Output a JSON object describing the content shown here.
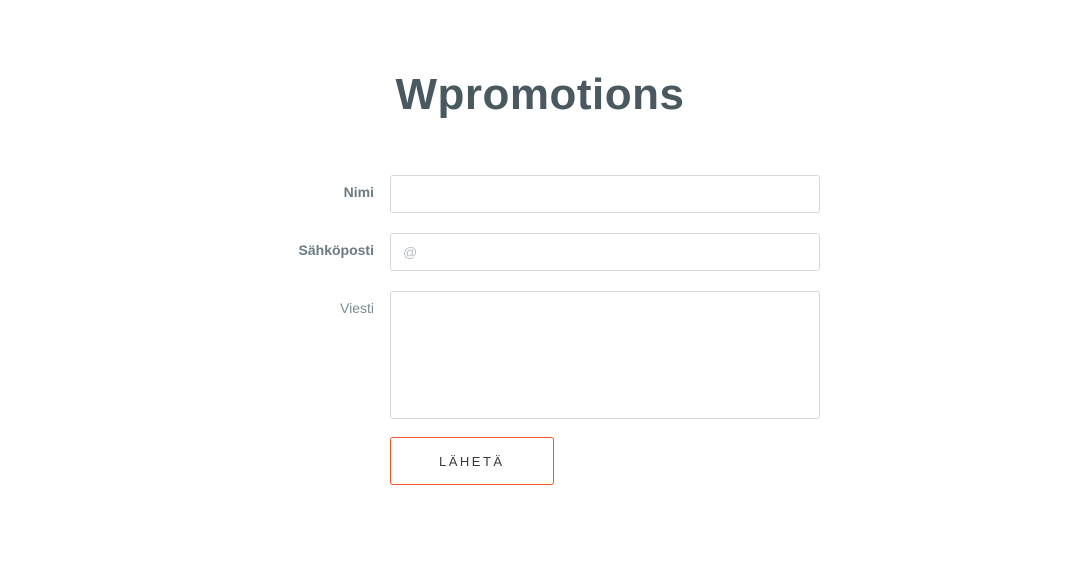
{
  "title": "Wpromotions",
  "form": {
    "name": {
      "label": "Nimi",
      "value": ""
    },
    "email": {
      "label": "Sähköposti",
      "placeholder": "@",
      "value": ""
    },
    "message": {
      "label": "Viesti",
      "value": ""
    },
    "submit": {
      "label": "Lähetä"
    }
  },
  "colors": {
    "accent": "#f45a2a",
    "titleColor": "#4a5860",
    "labelColor": "#7a8a94",
    "border": "#d5d9dd"
  }
}
